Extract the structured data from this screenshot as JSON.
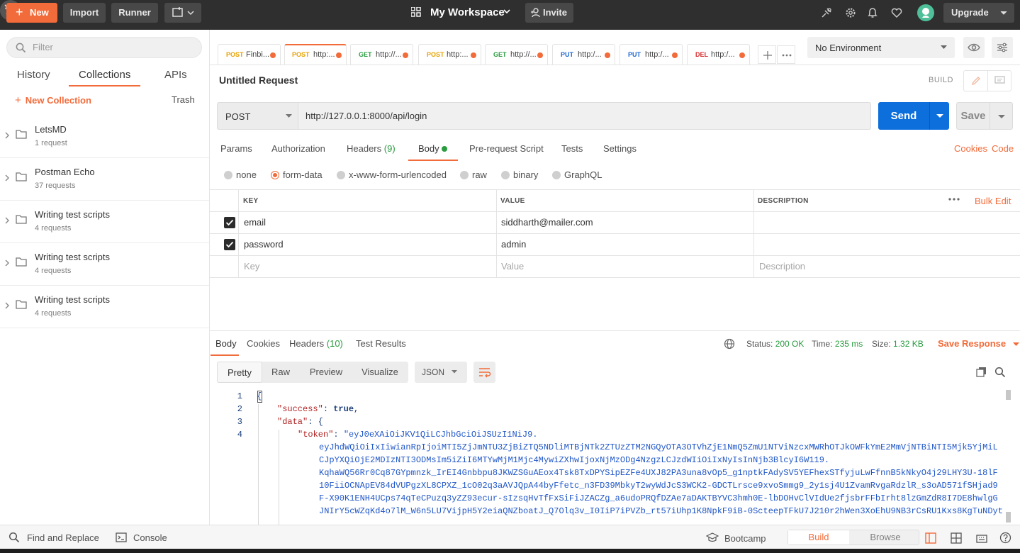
{
  "topbar": {
    "new_label": "New",
    "import_label": "Import",
    "runner_label": "Runner",
    "workspace": "My Workspace",
    "invite_label": "Invite",
    "upgrade_label": "Upgrade",
    "brand_color": "#f26b3a"
  },
  "sidebar": {
    "filter_placeholder": "Filter",
    "tabs": [
      "History",
      "Collections",
      "APIs"
    ],
    "active_tab": "Collections",
    "new_collection": "New Collection",
    "trash": "Trash",
    "collections": [
      {
        "name": "LetsMD",
        "count": "1 request"
      },
      {
        "name": "Postman Echo",
        "count": "37 requests"
      },
      {
        "name": "Writing test scripts",
        "count": "4 requests"
      },
      {
        "name": "Writing test scripts",
        "count": "4 requests"
      },
      {
        "name": "Writing test scripts",
        "count": "4 requests"
      }
    ]
  },
  "request_tabs": [
    {
      "method": "POST",
      "url": "Finbi..."
    },
    {
      "method": "POST",
      "url": "http:..."
    },
    {
      "method": "GET",
      "url": "http://..."
    },
    {
      "method": "POST",
      "url": "http:..."
    },
    {
      "method": "GET",
      "url": "http://..."
    },
    {
      "method": "PUT",
      "url": "http:/..."
    },
    {
      "method": "PUT",
      "url": "http:/..."
    },
    {
      "method": "DEL",
      "url": "http:/..."
    }
  ],
  "environment": "No Environment",
  "request": {
    "title": "Untitled Request",
    "build_label": "BUILD",
    "method": "POST",
    "url": "http://127.0.0.1:8000/api/login",
    "send_label": "Send",
    "save_label": "Save",
    "subtabs": {
      "params": "Params",
      "authorization": "Authorization",
      "headers": "Headers",
      "headers_count": "(9)",
      "body": "Body",
      "prerequest": "Pre-request Script",
      "tests": "Tests",
      "settings": "Settings"
    },
    "cookies_link": "Cookies",
    "code_link": "Code",
    "body_types": [
      "none",
      "form-data",
      "x-www-form-urlencoded",
      "raw",
      "binary",
      "GraphQL"
    ],
    "selected_body_type": "form-data",
    "table": {
      "headers": [
        "KEY",
        "VALUE",
        "DESCRIPTION"
      ],
      "bulk_edit": "Bulk Edit",
      "rows": [
        {
          "key": "email",
          "value": "siddharth@mailer.com",
          "checked": true
        },
        {
          "key": "password",
          "value": "admin",
          "checked": true
        }
      ],
      "placeholders": {
        "key": "Key",
        "value": "Value",
        "description": "Description"
      }
    }
  },
  "response": {
    "tabs": {
      "body": "Body",
      "cookies": "Cookies",
      "headers": "Headers",
      "headers_count": "(10)",
      "test_results": "Test Results"
    },
    "status_label": "Status:",
    "status": "200 OK",
    "time_label": "Time:",
    "time": "235 ms",
    "size_label": "Size:",
    "size": "1.32 KB",
    "save_response": "Save Response",
    "views": [
      "Pretty",
      "Raw",
      "Preview",
      "Visualize"
    ],
    "active_view": "Pretty",
    "format": "JSON",
    "line_numbers": [
      "1",
      "2",
      "3",
      "4"
    ],
    "code": {
      "open_brace": "{",
      "success_key": "\"success\"",
      "success_val": "true",
      "data_key": "\"data\"",
      "token_key": "\"token\"",
      "token_lines": [
        "\"eyJ0eXAiOiJKV1QiLCJhbGciOiJSUzI1NiJ9.",
        "eyJhdWQiOiIxIiwianRpIjoiMTI5ZjJmNTU3ZjBiZTQ5NDliMTBjNTk2ZTUzZTM2NGQyOTA3OTVhZjE1NmQ5ZmU1NTViNzcxMWRhOTJkOWFkYmE2MmVjNTBiNTI5Mjk5YjMiL",
        "CJpYXQiOjE2MDIzNTI3ODMsIm5iZiI6MTYwMjM1Mjc4MywiZXhwIjoxNjMzODg4NzgzLCJzdWIiOiIxNyIsInNjb3BlcyI6W119.",
        "KqhaWQ56Rr0Cq87GYpmnzk_IrEI4Gnbbpu8JKWZSGuAEox4Tsk8TxDPYSipEZFe4UXJ82PA3una8vOp5_g1nptkFAdySV5YEFhexSTfyjuLwFfnnB5kNkyO4j29LHY3U-18lF",
        "10FiiOCNApEV84dVUPgzXL8CPXZ_1cO02q3aAVJQpA44byFfetc_n3FD39MbkyT2wyWdJcS3WCK2-GDCTLrsce9xvoSmmg9_2y1sj4U1ZvamRvgaRdzlR_s3oAD571fSHjad9",
        "F-X90K1ENH4UCps74qTeCPuzq3yZZ93ecur-sIzsqHvTfFxSiFiJZACZg_a6udoPRQfDZAe7aDAKTBYVC3hmh0E-lbDOHvClVIdUe2fjsbrFFbIrht8lzGmZdR8I7DE8hwlgG",
        "JNIrY5cWZqKd4o7lM_W6n5LU7VijpH5Y2eiaQNZboatJ_Q7Olq3v_I0IiP7iPVZb_rt57iUhp1K8NpkF9iB-0ScteepTFkU7J210r2hWen3XoEhU9NB3rCsRU1Kxs8KgTuNDyt"
      ]
    }
  },
  "statusbar": {
    "find_replace": "Find and Replace",
    "console": "Console",
    "bootcamp": "Bootcamp",
    "build": "Build",
    "browse": "Browse"
  }
}
